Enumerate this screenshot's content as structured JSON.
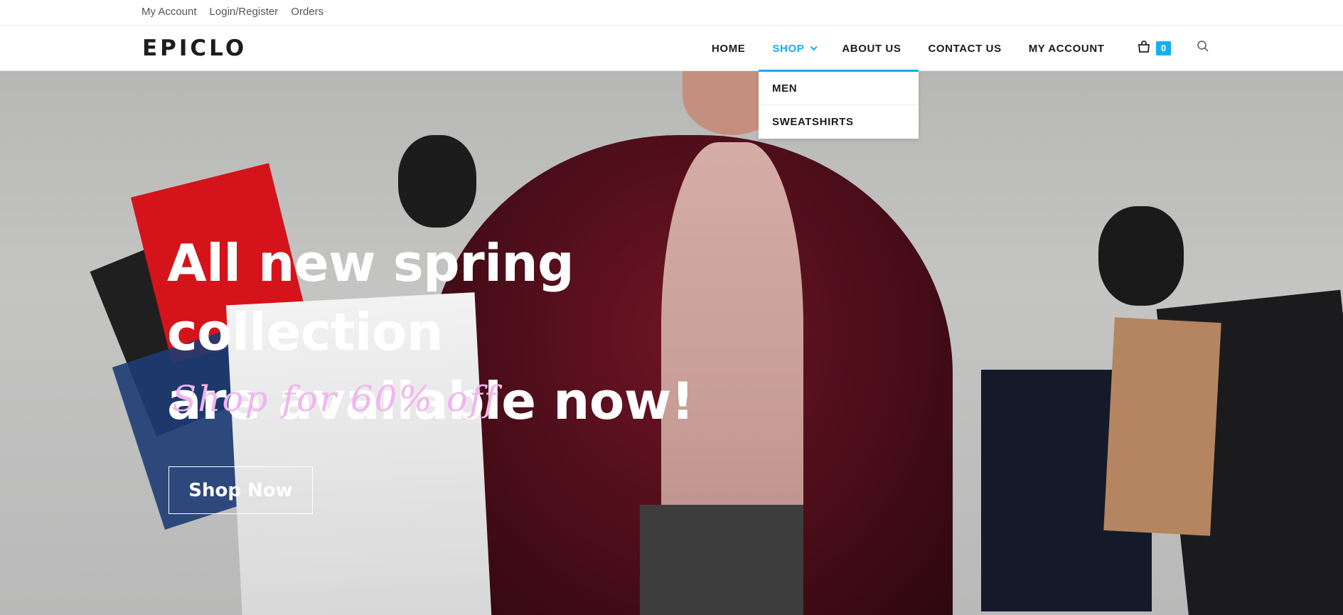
{
  "topbar": {
    "links": [
      "My Account",
      "Login/Register",
      "Orders"
    ]
  },
  "header": {
    "logo": "EPICLO",
    "nav": [
      "HOME",
      "SHOP",
      "ABOUT US",
      "CONTACT US",
      "MY ACCOUNT"
    ],
    "active_nav": "SHOP",
    "cart_count": "0",
    "cart_icon": "shopping-bag-icon",
    "search_icon": "search-icon"
  },
  "dropdown": {
    "items": [
      "MEN",
      "SWEATSHIRTS"
    ]
  },
  "hero": {
    "headline_line1": "All new spring collection",
    "headline_line2": "are available now!",
    "subheadline": "Shop for 60% off",
    "cta_label": "Shop Now"
  },
  "colors": {
    "accent": "#13aff0",
    "subheadline": "#f0b6ee"
  }
}
